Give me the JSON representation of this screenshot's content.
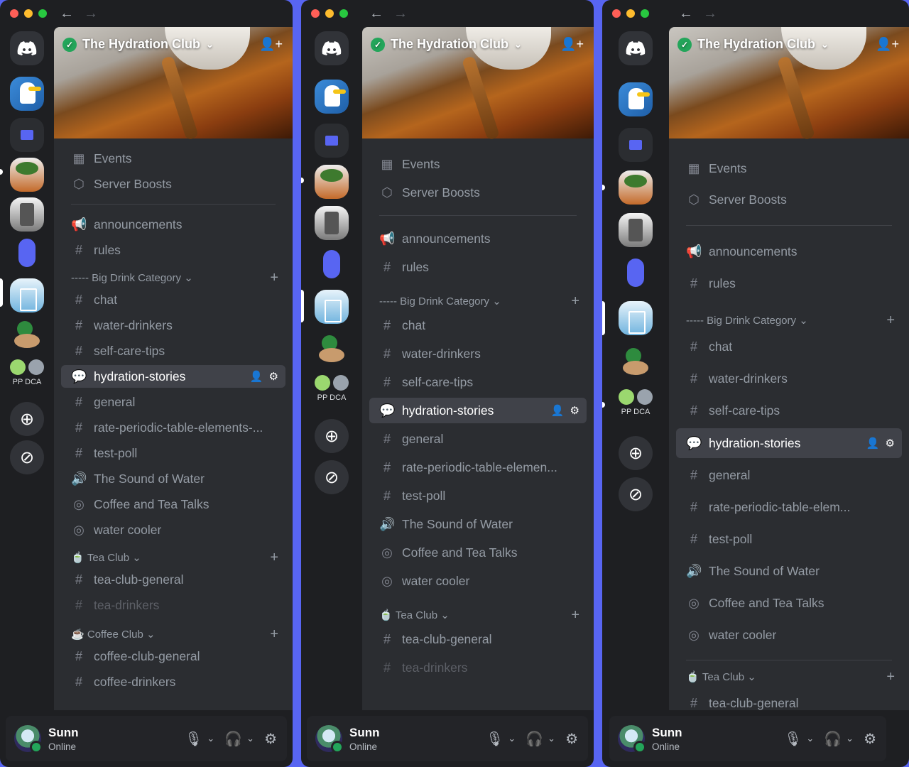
{
  "server": {
    "name": "The Hydration Club",
    "items": [
      "Events",
      "Server Boosts"
    ]
  },
  "channels": {
    "announcements": "announcements",
    "rules": "rules",
    "big_drink_category": "----- Big Drink Category",
    "chat": "chat",
    "water_drinkers": "water-drinkers",
    "self_care_tips": "self-care-tips",
    "hydration_stories": "hydration-stories",
    "general": "general",
    "rate_full": "rate-periodic-table-elements-...",
    "rate_mid": "rate-periodic-table-elemen...",
    "rate_short": "rate-periodic-table-elem...",
    "test_poll": "test-poll",
    "sound_of_water": "The Sound of Water",
    "coffee_tea_talks": "Coffee and Tea Talks",
    "water_cooler": "water cooler",
    "tea_club": "Tea Club",
    "tea_club_general": "tea-club-general",
    "tea_drinkers": "tea-drinkers",
    "coffee_club": "Coffee Club",
    "coffee_club_general": "coffee-club-general",
    "coffee_drinkers": "coffee-drinkers"
  },
  "rail": {
    "dual_label_1": "PP",
    "dual_label_2": "DCA"
  },
  "user": {
    "name": "Sunn",
    "status": "Online"
  },
  "colors": {
    "accent": "#5865f2",
    "online": "#23a55a",
    "sidebar": "#2b2d31",
    "rail": "#1e1f22"
  }
}
